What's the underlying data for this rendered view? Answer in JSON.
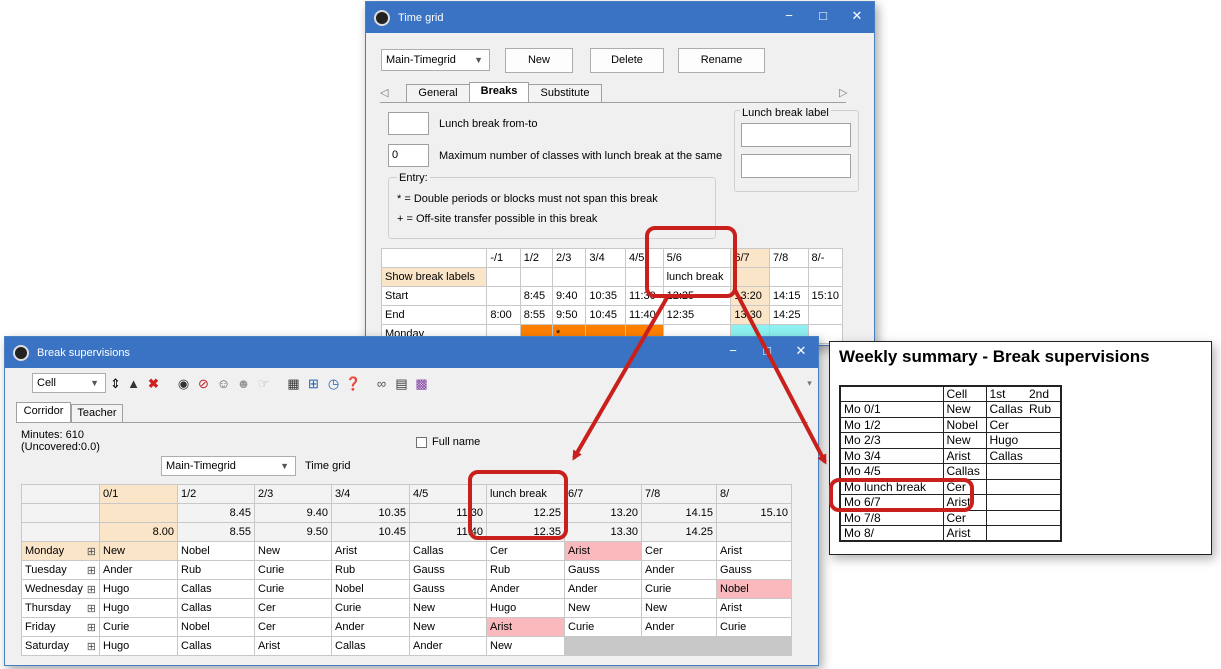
{
  "timegrid_window": {
    "title": "Time grid",
    "timegrid_select": "Main-Timegrid",
    "new_label": "New",
    "delete_label": "Delete",
    "rename_label": "Rename",
    "tabs": [
      "General",
      "Breaks",
      "Substitute"
    ],
    "lunch_from_to_value": "",
    "lunch_from_to_label": "Lunch break from-to",
    "max_classes_value": "0",
    "max_classes_label": "Maximum number of classes with lunch break at the same",
    "lunch_label_group": "Lunch break label",
    "entry_title": "Entry:",
    "entry_line1": "* = Double periods or blocks must not span this break",
    "entry_line2": "+ = Off-site transfer possible in this break",
    "grid": {
      "columns": [
        "-/1",
        "1/2",
        "2/3",
        "3/4",
        "4/5",
        "5/6",
        "6/7",
        "7/8",
        "8/-"
      ],
      "rows": [
        {
          "label": "Show break labels",
          "cells": [
            "",
            "",
            "",
            "",
            "",
            "lunch break",
            "",
            "",
            ""
          ]
        },
        {
          "label": "Start",
          "cells": [
            "",
            "8:45",
            "9:40",
            "10:35",
            "11:30",
            "12:25",
            "13:20",
            "14:15",
            "15:10"
          ]
        },
        {
          "label": "End",
          "cells": [
            "8:00",
            "8:55",
            "9:50",
            "10:45",
            "11:40",
            "12:35",
            "13:30",
            "14:25",
            ""
          ]
        },
        {
          "label": "Monday",
          "cells": [
            "",
            "",
            "*",
            "",
            "",
            "",
            "",
            "",
            ""
          ]
        }
      ]
    }
  },
  "break_window": {
    "title": "Break supervisions",
    "view_select": "Cell",
    "tabs": [
      "Corridor",
      "Teacher"
    ],
    "minutes": "Minutes: 610",
    "uncovered": "(Uncovered:0.0)",
    "full_name": "Full name",
    "timegrid_select": "Main-Timegrid",
    "timegrid_label": "Time grid",
    "columns": [
      "0/1",
      "1/2",
      "2/3",
      "3/4",
      "4/5",
      "lunch break",
      "6/7",
      "7/8",
      "8/"
    ],
    "start_row": [
      "",
      "8.45",
      "9.40",
      "10.35",
      "11.30",
      "12.25",
      "13.20",
      "14.15",
      "15.10"
    ],
    "end_row": [
      "8.00",
      "8.55",
      "9.50",
      "10.45",
      "11.40",
      "12.35",
      "13.30",
      "14.25",
      ""
    ],
    "days": [
      {
        "day": "Monday",
        "cells": [
          "New",
          "Nobel",
          "New",
          "Arist",
          "Callas",
          "Cer",
          "Arist",
          "Cer",
          "Arist"
        ]
      },
      {
        "day": "Tuesday",
        "cells": [
          "Ander",
          "Rub",
          "Curie",
          "Rub",
          "Gauss",
          "Rub",
          "Gauss",
          "Ander",
          "Gauss"
        ]
      },
      {
        "day": "Wednesday",
        "cells": [
          "Hugo",
          "Callas",
          "Curie",
          "Nobel",
          "Gauss",
          "Ander",
          "Ander",
          "Curie",
          "Nobel"
        ]
      },
      {
        "day": "Thursday",
        "cells": [
          "Hugo",
          "Callas",
          "Cer",
          "Curie",
          "New",
          "Hugo",
          "New",
          "New",
          "Arist"
        ]
      },
      {
        "day": "Friday",
        "cells": [
          "Curie",
          "Nobel",
          "Cer",
          "Ander",
          "New",
          "Arist",
          "Curie",
          "Ander",
          "Curie"
        ]
      },
      {
        "day": "Saturday",
        "cells": [
          "Hugo",
          "Callas",
          "Arist",
          "Callas",
          "Ander",
          "New",
          "",
          "",
          ""
        ]
      }
    ]
  },
  "summary": {
    "title": "Weekly summary - Break supervisions",
    "header": [
      "",
      "Cell",
      "1st",
      "2nd"
    ],
    "rows": [
      [
        "Mo 0/1",
        "New",
        "Callas",
        "Rub"
      ],
      [
        "Mo 1/2",
        "Nobel",
        "Cer",
        ""
      ],
      [
        "Mo 2/3",
        "New",
        "Hugo",
        ""
      ],
      [
        "Mo 3/4",
        "Arist",
        "Callas",
        ""
      ],
      [
        "Mo 4/5",
        "Callas",
        "",
        ""
      ],
      [
        "Mo lunch break",
        "Cer",
        "",
        ""
      ],
      [
        "Mo 6/7",
        "Arist",
        "",
        ""
      ],
      [
        "Mo 7/8",
        "Cer",
        "",
        ""
      ],
      [
        "Mo 8/",
        "Arist",
        "",
        ""
      ]
    ]
  },
  "colors": {
    "titlebar": "#3a73c4",
    "orange": "#ff8000",
    "cyan": "#8ef0f0",
    "peach": "#fbe5c8",
    "pink": "#f9b9bd",
    "annotation_red": "#c9201c"
  }
}
